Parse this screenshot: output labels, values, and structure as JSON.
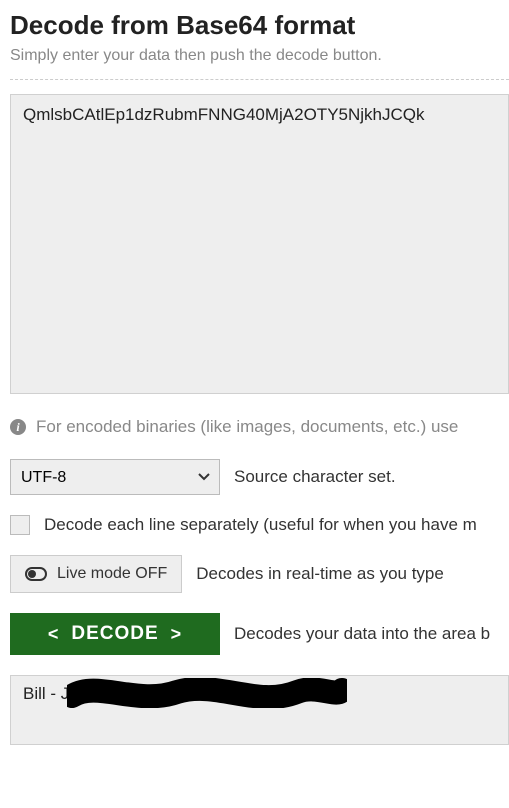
{
  "header": {
    "title": "Decode from Base64 format",
    "subtitle": "Simply enter your data then push the decode button."
  },
  "input": {
    "value": "QmlsbCAtlEp1dzRubmFNNG40MjA2OTY5NjkhJCQk"
  },
  "hint": {
    "icon": "i",
    "text": "For encoded binaries (like images, documents, etc.) use"
  },
  "charset": {
    "selected": "UTF-8",
    "description": "Source character set."
  },
  "perline": {
    "label": "Decode each line separately (useful for when you have m"
  },
  "live": {
    "label": "Live mode OFF",
    "description": "Decodes in real-time as you type "
  },
  "decode": {
    "label": "DECODE",
    "left": "<",
    "right": ">",
    "description": "Decodes your data into the area b"
  },
  "output": {
    "value": "Bill - J"
  }
}
